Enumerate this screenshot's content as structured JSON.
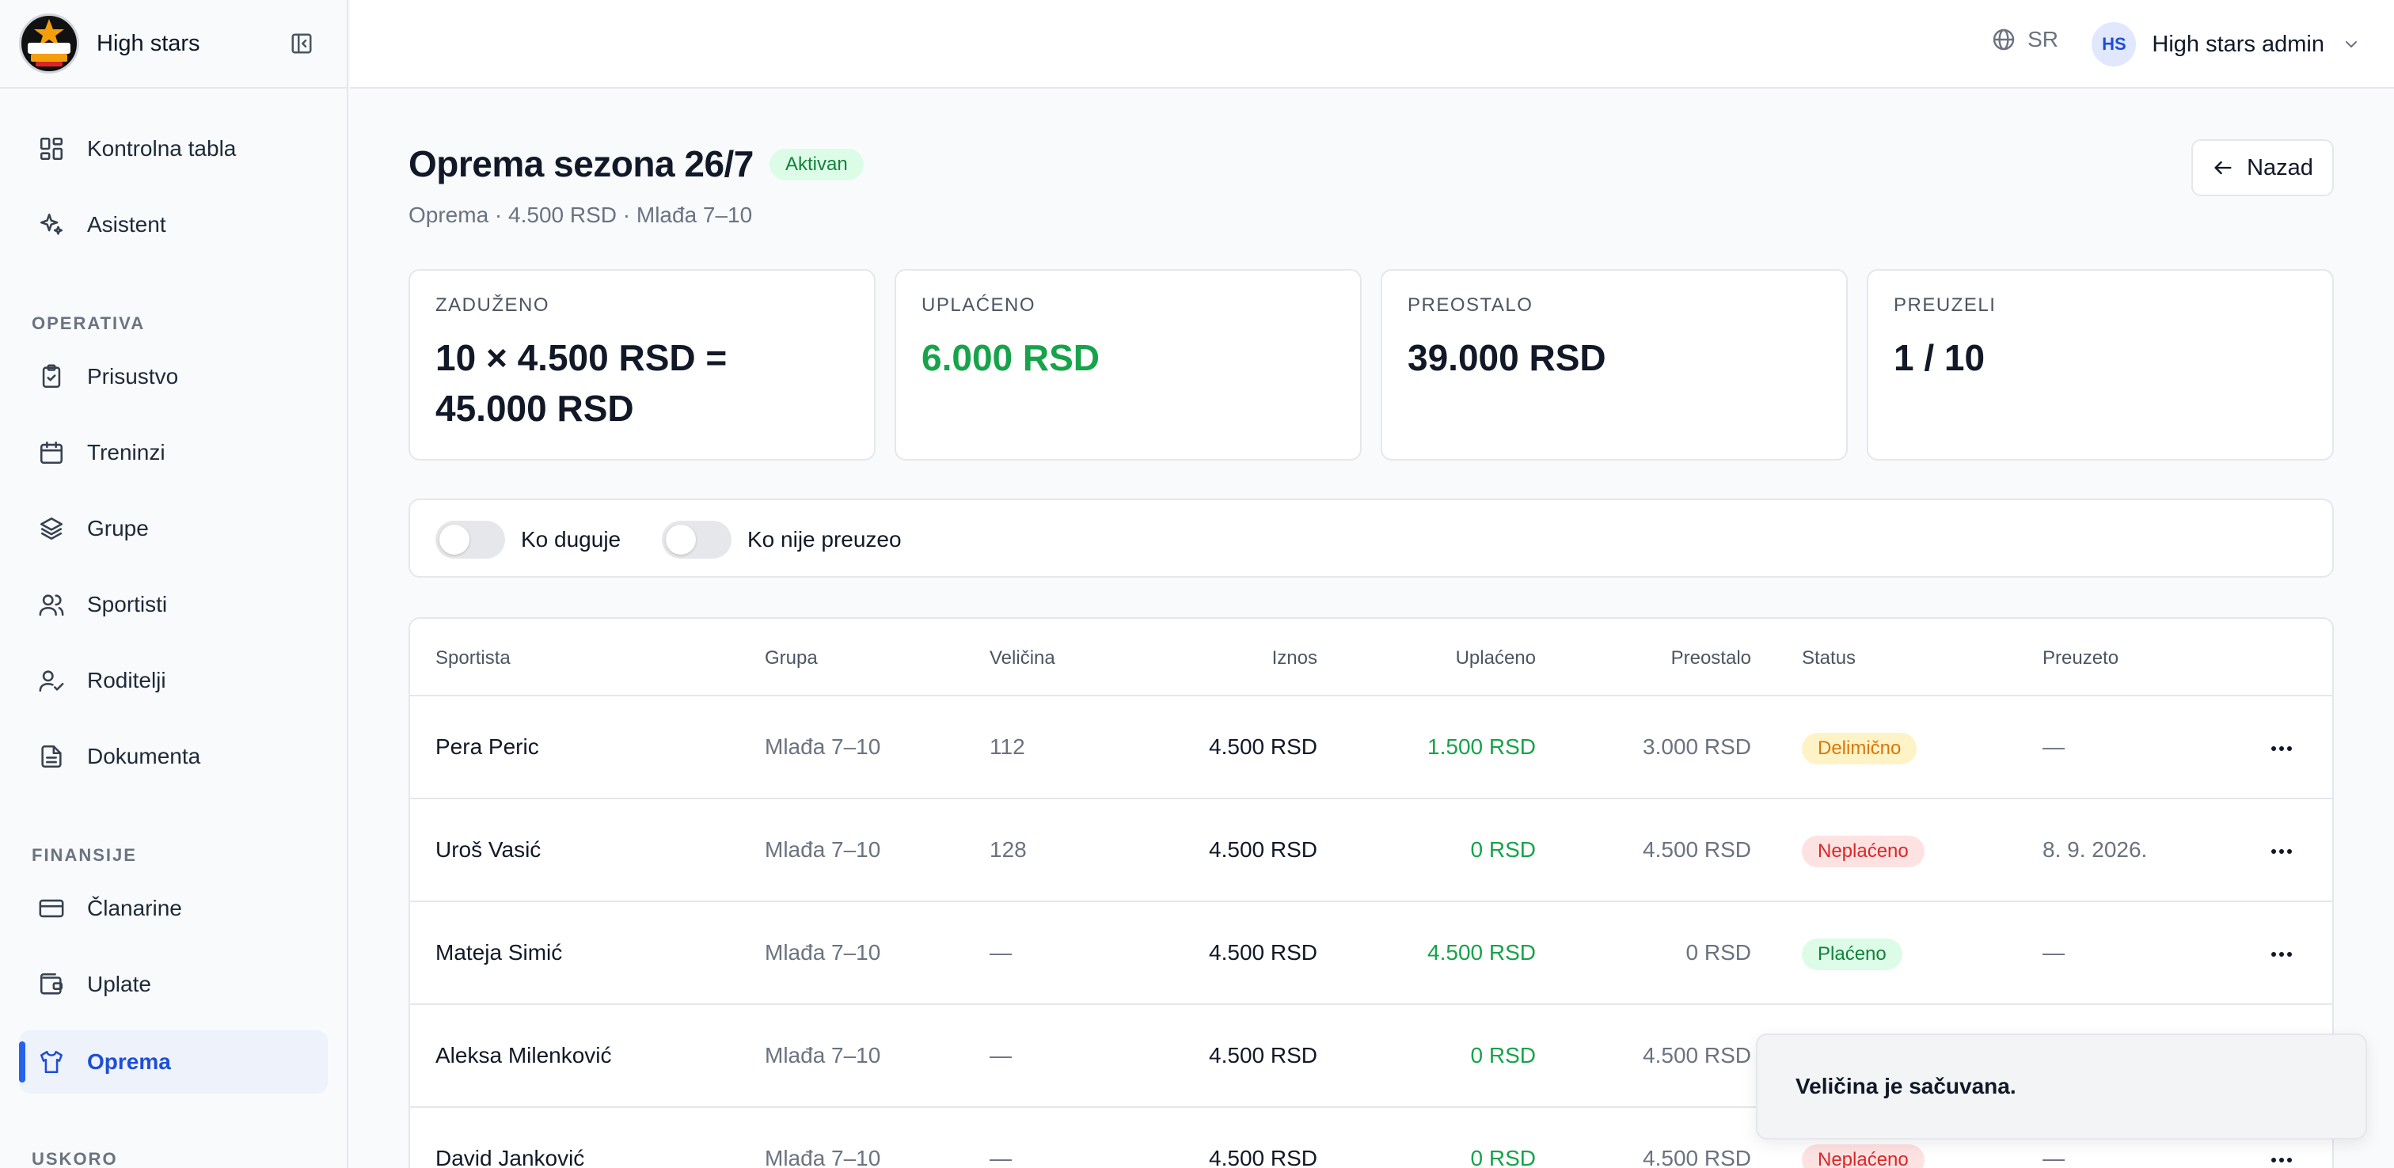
{
  "brand": {
    "name": "High stars"
  },
  "sidebar": {
    "items": [
      {
        "label": "Kontrolna tabla"
      },
      {
        "label": "Asistent"
      },
      {
        "label": "Prisustvo"
      },
      {
        "label": "Treninzi"
      },
      {
        "label": "Grupe"
      },
      {
        "label": "Sportisti"
      },
      {
        "label": "Roditelji"
      },
      {
        "label": "Dokumenta"
      },
      {
        "label": "Članarine"
      },
      {
        "label": "Uplate"
      },
      {
        "label": "Oprema"
      }
    ],
    "sections": {
      "operativa": "OPERATIVA",
      "finansije": "FINANSIJE",
      "uskoro": "USKORO"
    }
  },
  "header": {
    "language": "SR",
    "user": {
      "initials": "HS",
      "name": "High stars admin"
    }
  },
  "main": {
    "title": "Oprema sezona 26/7",
    "status": "Aktivan",
    "subtitle": "Oprema · 4.500 RSD · Mlađa 7–10",
    "back_label": "Nazad",
    "stats": [
      {
        "label": "ZADUŽENO",
        "value_line1": "10 × 4.500 RSD =",
        "value_line2": "45.000 RSD"
      },
      {
        "label": "UPLAĆENO",
        "value": "6.000 RSD"
      },
      {
        "label": "PREOSTALO",
        "value": "39.000 RSD"
      },
      {
        "label": "PREUZELI",
        "value": "1 / 10"
      }
    ],
    "filters": {
      "debt": "Ko duguje",
      "not_picked": "Ko nije preuzeo"
    },
    "table": {
      "columns": {
        "athlete": "Sportista",
        "group": "Grupa",
        "size": "Veličina",
        "amount": "Iznos",
        "paid": "Uplaćeno",
        "remaining": "Preostalo",
        "status": "Status",
        "picked": "Preuzeto"
      },
      "rows": [
        {
          "name": "Pera Peric",
          "group": "Mlađa 7–10",
          "size": "112",
          "amount": "4.500 RSD",
          "paid": "1.500 RSD",
          "remaining": "3.000 RSD",
          "status": "Delimično",
          "picked": "—"
        },
        {
          "name": "Uroš Vasić",
          "group": "Mlađa 7–10",
          "size": "128",
          "amount": "4.500 RSD",
          "paid": "0 RSD",
          "remaining": "4.500 RSD",
          "status": "Neplaćeno",
          "picked": "8. 9. 2026."
        },
        {
          "name": "Mateja Simić",
          "group": "Mlađa 7–10",
          "size": "—",
          "amount": "4.500 RSD",
          "paid": "4.500 RSD",
          "remaining": "0 RSD",
          "status": "Plaćeno",
          "picked": "—"
        },
        {
          "name": "Aleksa Milenković",
          "group": "Mlađa 7–10",
          "size": "—",
          "amount": "4.500 RSD",
          "paid": "0 RSD",
          "remaining": "4.500 RSD",
          "status": "",
          "picked": ""
        },
        {
          "name": "David Janković",
          "group": "Mlađa 7–10",
          "size": "—",
          "amount": "4.500 RSD",
          "paid": "0 RSD",
          "remaining": "4.500 RSD",
          "status": "Neplaćeno",
          "picked": "—"
        }
      ]
    }
  },
  "toast": {
    "message": "Veličina je sačuvana."
  },
  "colors": {
    "accent": "#2563eb",
    "green": "#16a34a",
    "amber": "#d97706",
    "red": "#dc2626"
  }
}
